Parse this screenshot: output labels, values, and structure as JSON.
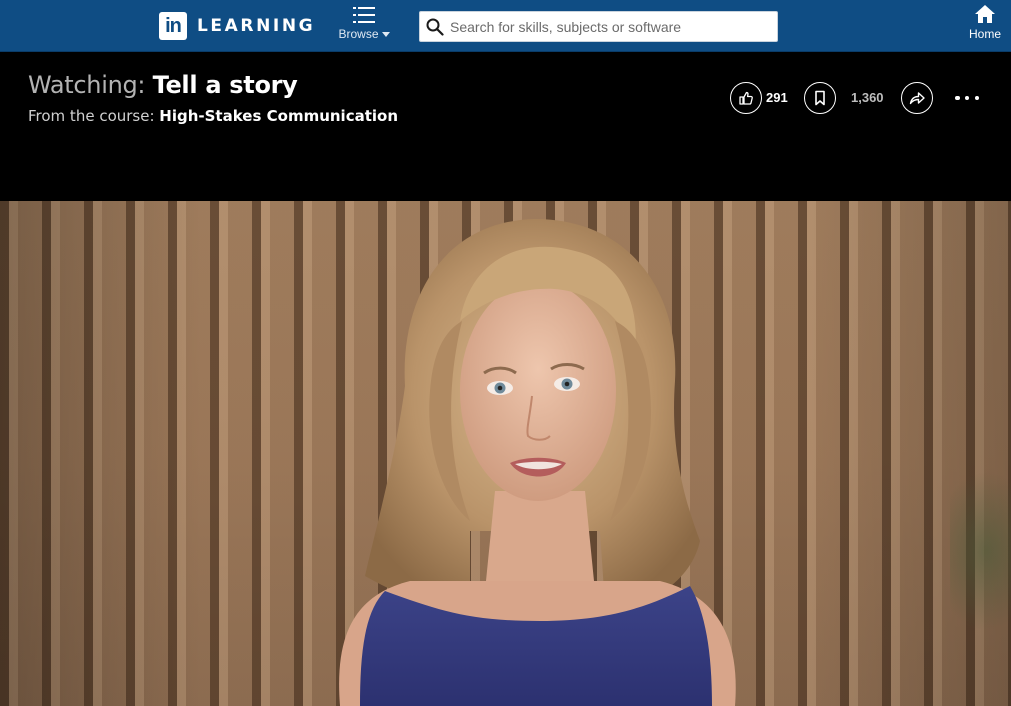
{
  "nav": {
    "logo_mark": "in",
    "logo_text": "LEARNING",
    "browse_label": "Browse",
    "search_placeholder": "Search for skills, subjects or software",
    "home_label": "Home",
    "brand_color": "#0f4d84"
  },
  "video_header": {
    "watching_prefix": "Watching:",
    "video_title": "Tell a story",
    "from_prefix": "From the course:",
    "course_title": "High-Stakes Communication"
  },
  "actions": {
    "like_count": "291",
    "save_count": "1,360",
    "icons": [
      "like-icon",
      "bookmark-icon",
      "share-icon",
      "more-icon"
    ]
  }
}
